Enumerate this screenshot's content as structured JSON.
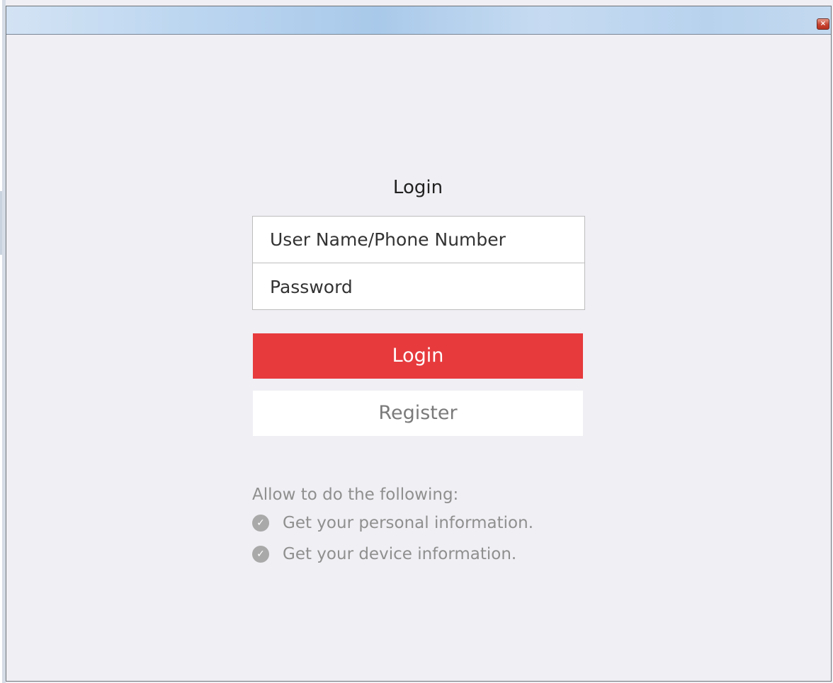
{
  "window": {
    "close_glyph": "×"
  },
  "login": {
    "title": "Login",
    "username_placeholder": "User Name/Phone Number",
    "password_placeholder": "Password",
    "login_button": "Login",
    "register_button": "Register"
  },
  "permissions": {
    "heading": "Allow to do the following:",
    "items": [
      {
        "icon": "check-circle-icon",
        "label": "Get your personal information."
      },
      {
        "icon": "check-circle-icon",
        "label": "Get your device information."
      }
    ]
  },
  "colors": {
    "accent": "#e63a3d",
    "background": "#f0eff4",
    "muted_text": "#8f8f8f"
  }
}
